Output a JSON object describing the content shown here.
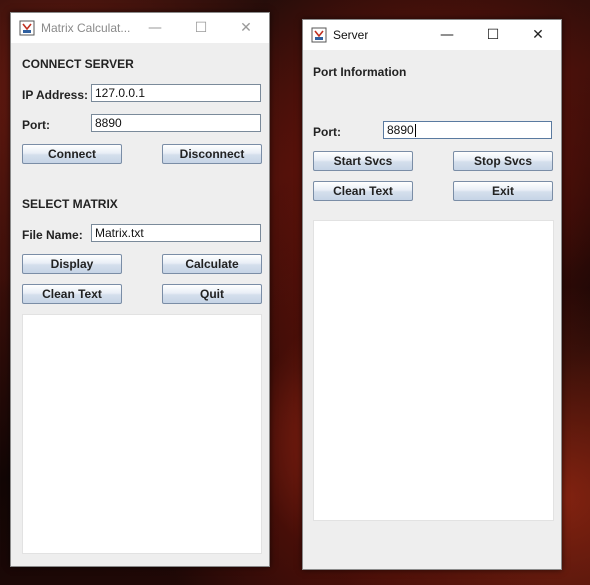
{
  "client": {
    "title": "Matrix Calculat...",
    "controls": {
      "minimize": "—",
      "maximize": "☐",
      "close": "✕"
    },
    "connect_heading": "CONNECT SERVER",
    "ip_label": "IP Address:",
    "ip_value": "127.0.0.1",
    "port_label": "Port:",
    "port_value": "8890",
    "connect_button": "Connect",
    "disconnect_button": "Disconnect",
    "matrix_heading": "SELECT MATRIX",
    "file_label": "File Name:",
    "file_value": "Matrix.txt",
    "display_button": "Display",
    "calculate_button": "Calculate",
    "clean_button": "Clean Text",
    "quit_button": "Quit",
    "output_text": ""
  },
  "server": {
    "title": "Server",
    "controls": {
      "minimize": "—",
      "maximize": "☐",
      "close": "✕"
    },
    "heading": "Port Information",
    "port_label": "Port:",
    "port_value": "8890",
    "start_button": "Start Svcs",
    "stop_button": "Stop Svcs",
    "clean_button": "Clean Text",
    "exit_button": "Exit",
    "output_text": ""
  }
}
